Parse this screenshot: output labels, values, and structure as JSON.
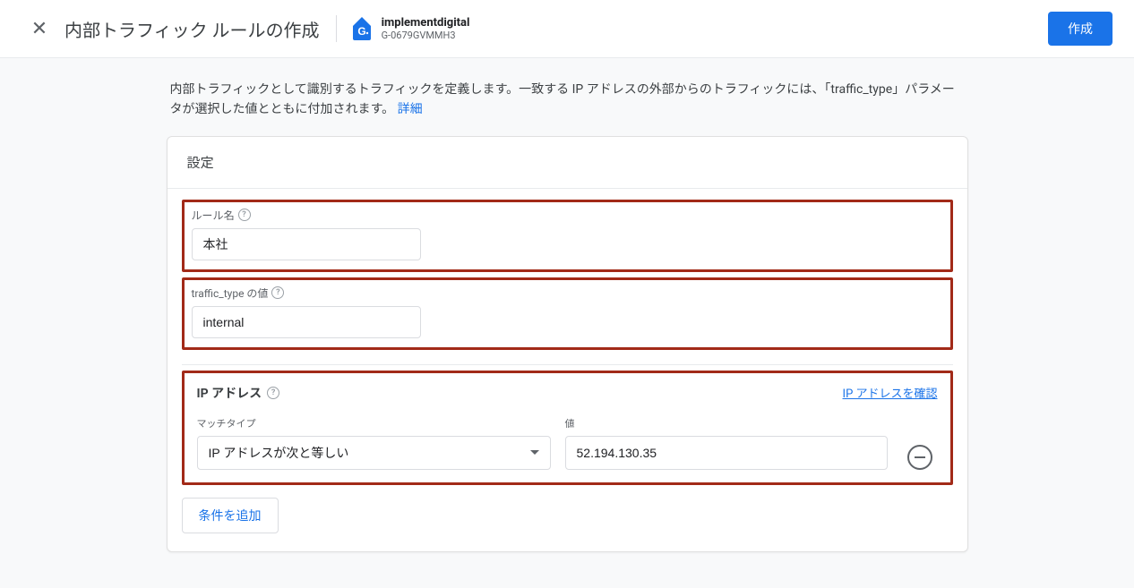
{
  "header": {
    "page_title": "内部トラフィック ルールの作成",
    "property_name": "implementdigital",
    "property_id": "G-0679GVMMH3",
    "create_button": "作成"
  },
  "description": {
    "text_part1": "内部トラフィックとして識別するトラフィックを定義します。一致する IP アドレスの外部からのトラフィックには、「traffic_type」パラメータが選択した値とともに付加されます。",
    "link_text": "詳細"
  },
  "settings": {
    "section_title": "設定",
    "rule_name_label": "ルール名",
    "rule_name_value": "本社",
    "traffic_type_label": "traffic_type の値",
    "traffic_type_value": "internal",
    "ip_section": {
      "title": "IP アドレス",
      "check_link": "IP アドレスを確認",
      "match_type_label": "マッチタイプ",
      "match_type_value": "IP アドレスが次と等しい",
      "value_label": "値",
      "value_value": "52.194.130.35"
    },
    "add_condition_button": "条件を追加"
  }
}
